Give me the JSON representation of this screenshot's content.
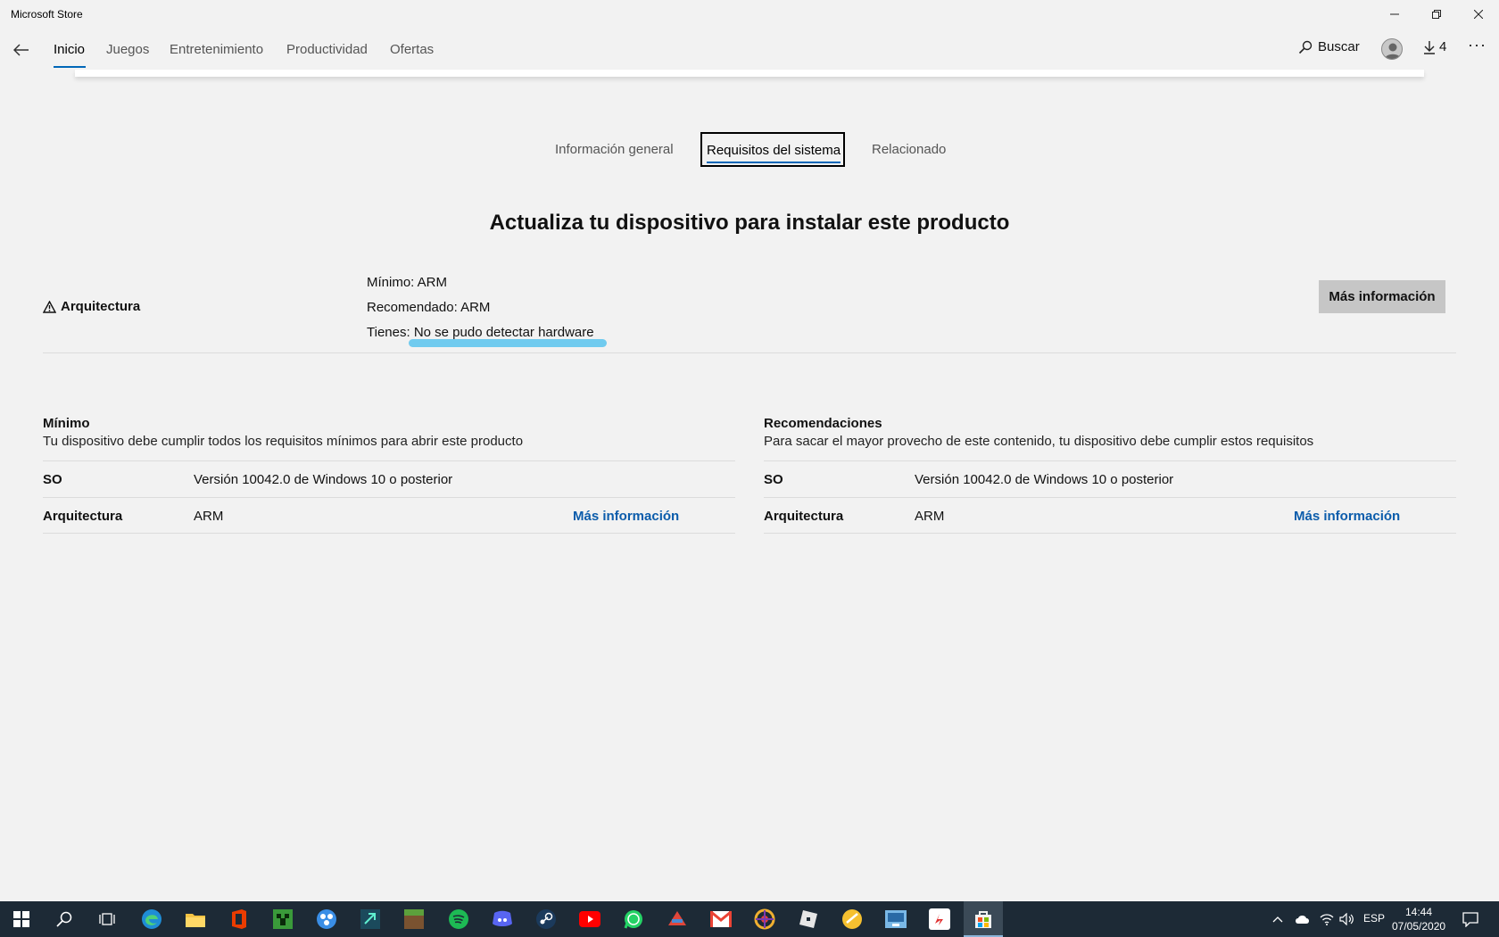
{
  "window": {
    "title": "Microsoft Store"
  },
  "nav": {
    "tabs": [
      {
        "label": "Inicio"
      },
      {
        "label": "Juegos"
      },
      {
        "label": "Entretenimiento"
      },
      {
        "label": "Productividad"
      },
      {
        "label": "Ofertas"
      }
    ],
    "search_label": "Buscar",
    "downloads_count": "4",
    "more_label": "···"
  },
  "sections": {
    "tabs": [
      "Información general",
      "Requisitos del sistema",
      "Relacionado"
    ],
    "active": "Requisitos del sistema"
  },
  "heading": "Actualiza tu dispositivo para instalar este producto",
  "warning": {
    "label": "Arquitectura",
    "min_line": "Mínimo: ARM",
    "rec_line": "Recomendado: ARM",
    "have_prefix": "Tienes: ",
    "have_value": "No se pudo detectar hardware",
    "button": "Más información"
  },
  "minimum": {
    "title": "Mínimo",
    "subtitle": "Tu dispositivo debe cumplir todos los requisitos mínimos para abrir este producto",
    "rows": [
      {
        "key": "SO",
        "value": "Versión 10042.0 de Windows 10 o posterior",
        "link": ""
      },
      {
        "key": "Arquitectura",
        "value": "ARM",
        "link": "Más información"
      }
    ]
  },
  "recommended": {
    "title": "Recomendaciones",
    "subtitle": "Para sacar el mayor provecho de este contenido, tu dispositivo debe cumplir estos requisitos",
    "rows": [
      {
        "key": "SO",
        "value": "Versión 10042.0 de Windows 10 o posterior",
        "link": ""
      },
      {
        "key": "Arquitectura",
        "value": "ARM",
        "link": "Más información"
      }
    ]
  },
  "taskbar": {
    "language": "ESP",
    "time": "14:44",
    "date": "07/05/2020",
    "apps": [
      "start",
      "search",
      "task-view",
      "edge",
      "file-explorer",
      "office",
      "creeper-app",
      "app-circles",
      "app-arrow",
      "minecraft",
      "spotify",
      "discord",
      "steam",
      "youtube",
      "whatsapp",
      "app-red",
      "gmail",
      "app-wheel",
      "roblox",
      "app-yellow",
      "app-blue",
      "app-redwhite",
      "store"
    ],
    "colors": {
      "bg": "#1d2a36",
      "edge": "#1f8dd6",
      "spotify": "#1db954",
      "discord": "#5865f2",
      "youtube": "#ff0000",
      "whatsapp": "#25d366",
      "gmail": "#ea4335",
      "office": "#eb3c00"
    }
  }
}
